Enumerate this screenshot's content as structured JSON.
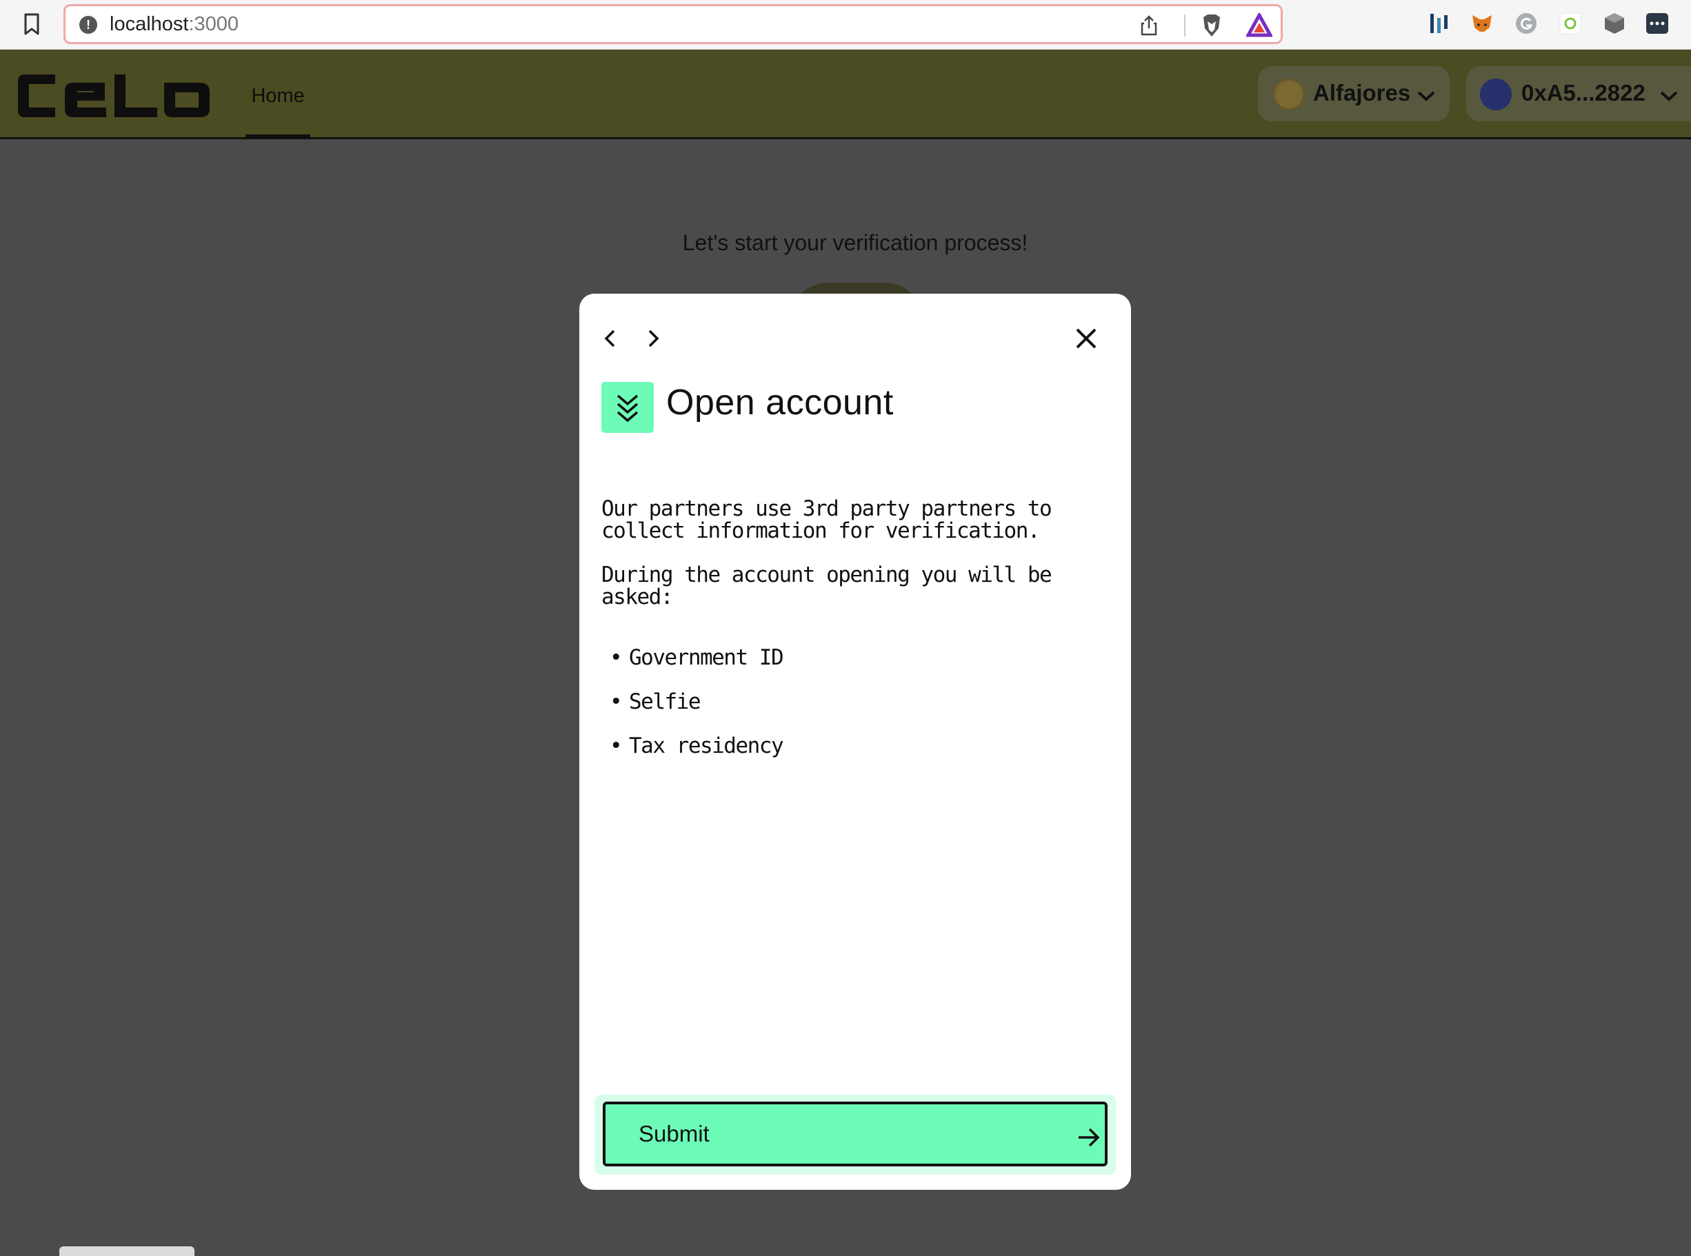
{
  "browser": {
    "url_host": "localhost",
    "url_port": ":3000",
    "extensions": [
      "bars-icon",
      "metamask-icon",
      "grammarly-icon",
      "leaf-icon",
      "cube-icon",
      "menu-dots-icon"
    ]
  },
  "header": {
    "logo_text": "celo",
    "nav": {
      "home_label": "Home"
    },
    "network_label": "Alfajores",
    "account_label": "0xA5...2822"
  },
  "page": {
    "heading": "Let's start your verification process!"
  },
  "modal": {
    "title": "Open account",
    "paragraph_1": "Our partners use 3rd party partners to collect information for verification.",
    "paragraph_2": "During the account opening you will be asked:",
    "requirements": [
      "Government ID",
      "Selfie",
      "Tax residency"
    ],
    "submit_label": "Submit"
  },
  "colors": {
    "accent": "#6cfcb8",
    "header_bg": "#4c4c22",
    "overlay_bg": "#4b4b4b"
  }
}
